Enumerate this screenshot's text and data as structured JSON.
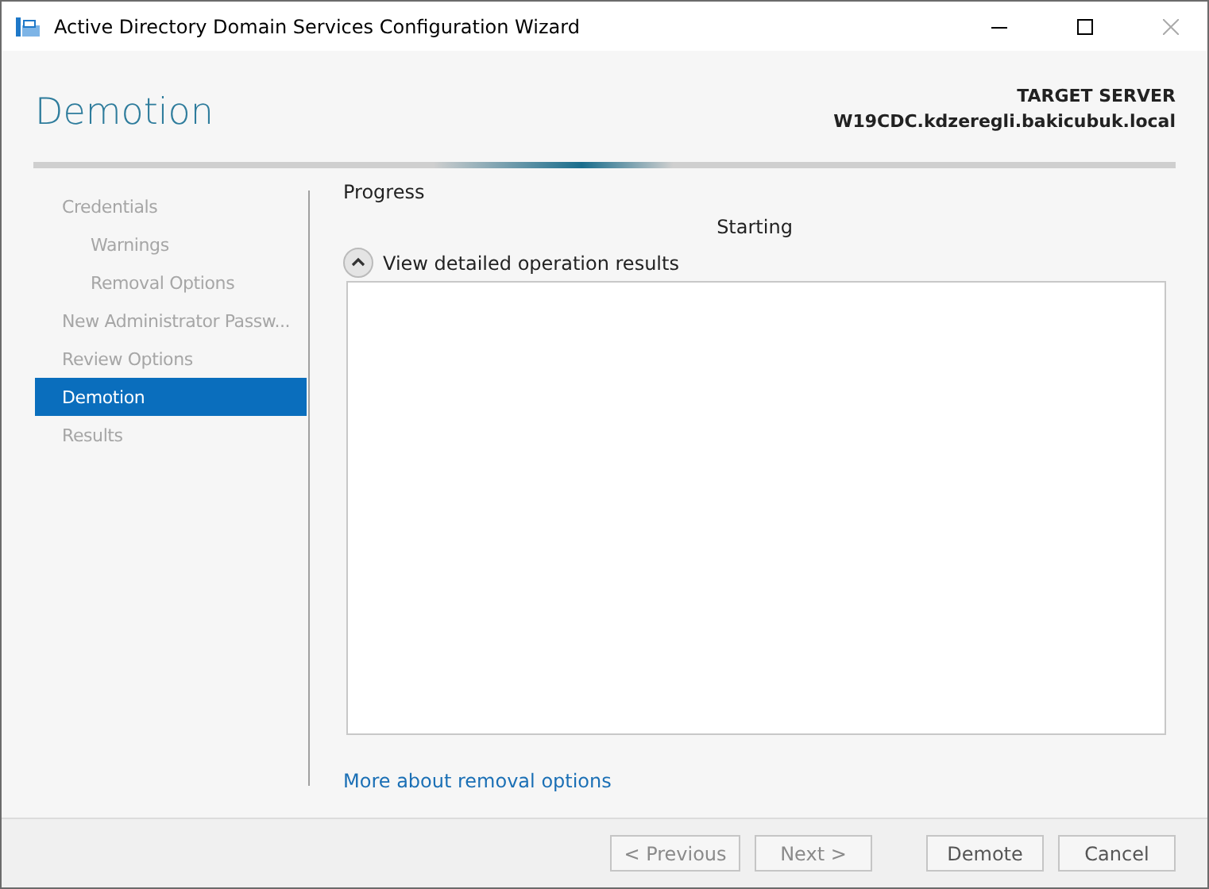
{
  "window": {
    "title": "Active Directory Domain Services Configuration Wizard"
  },
  "header": {
    "title": "Demotion",
    "target_label": "TARGET SERVER",
    "target_server": "W19CDC.kdzeregli.bakicubuk.local"
  },
  "steps": [
    {
      "label": "Credentials",
      "selected": false,
      "children": [
        {
          "label": "Warnings",
          "selected": false
        },
        {
          "label": "Removal Options",
          "selected": false
        }
      ]
    },
    {
      "label": "New Administrator Passw...",
      "selected": false
    },
    {
      "label": "Review Options",
      "selected": false
    },
    {
      "label": "Demotion",
      "selected": true
    },
    {
      "label": "Results",
      "selected": false
    }
  ],
  "progress": {
    "heading": "Progress",
    "status": "Starting",
    "details_label": "View detailed operation results",
    "details_expanded": true
  },
  "link": "More about removal options",
  "buttons": [
    {
      "label": "< Previous",
      "disabled": true
    },
    {
      "label": "Next >",
      "disabled": true
    },
    {
      "label": "Demote",
      "disabled": false
    },
    {
      "label": "Cancel",
      "disabled": false
    }
  ]
}
